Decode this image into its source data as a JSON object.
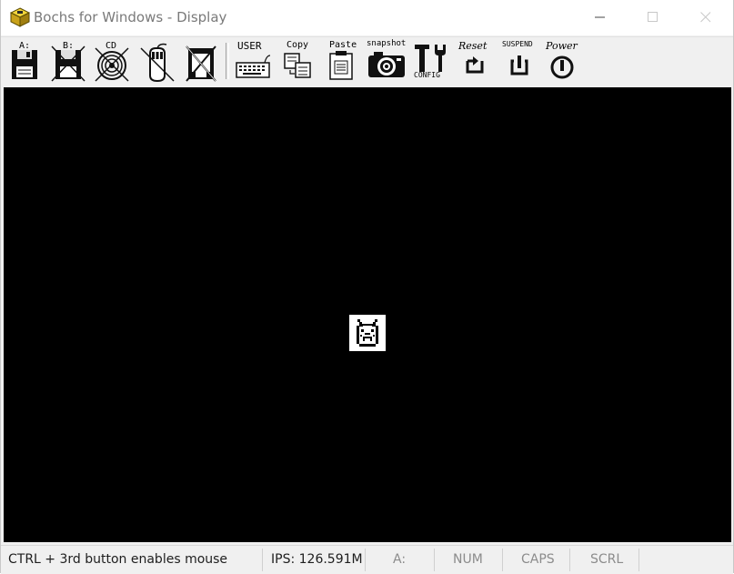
{
  "window": {
    "title": "Bochs for Windows - Display"
  },
  "toolbar": {
    "floppy_a": {
      "label": "A:",
      "icon": "floppy-disk-icon"
    },
    "floppy_b": {
      "label": "B:",
      "icon": "floppy-disk-disabled-icon"
    },
    "cdrom": {
      "label": "CD",
      "icon": "cdrom-disabled-icon"
    },
    "mouse": {
      "icon": "mouse-disabled-icon"
    },
    "usb": {
      "icon": "usb-disabled-icon"
    },
    "user": {
      "label": "USER",
      "icon": "keyboard-icon"
    },
    "copy": {
      "label": "Copy",
      "icon": "copy-icon"
    },
    "paste": {
      "label": "Paste",
      "icon": "paste-icon"
    },
    "snapshot": {
      "label": "snapshot",
      "icon": "camera-icon"
    },
    "config": {
      "label": "CONFIG",
      "icon": "config-tools-icon"
    },
    "reset": {
      "label": "Reset",
      "icon": "reset-icon"
    },
    "suspend": {
      "label": "SUSPEND",
      "icon": "suspend-icon"
    },
    "power": {
      "label": "Power",
      "icon": "power-icon"
    }
  },
  "statusbar": {
    "hint": "CTRL + 3rd button enables mouse",
    "ips": "IPS: 126.591M",
    "drive": "A:",
    "num": "NUM",
    "caps": "CAPS",
    "scrl": "SCRL"
  },
  "colors": {
    "display_bg": "#000000",
    "toolbar_bg": "#f0f0f0",
    "title_text": "#7a7a7a"
  }
}
